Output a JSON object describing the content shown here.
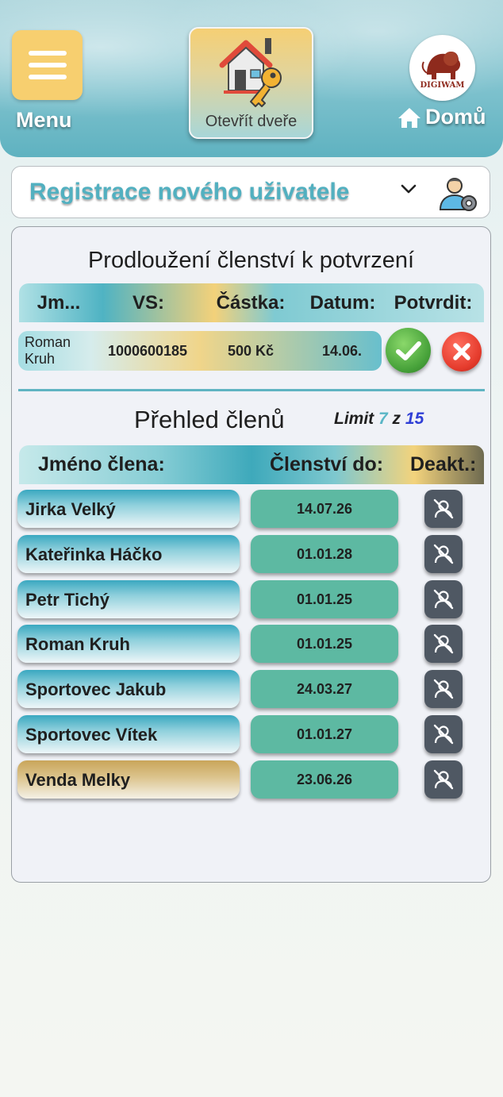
{
  "header": {
    "menu_label": "Menu",
    "door_button_label": "Otevřít dveře",
    "logo_text": "DIGIWAM",
    "home_label": "Domů"
  },
  "registration": {
    "title": "Registrace nového uživatele"
  },
  "pending": {
    "title": "Prodloužení členství k potvrzení",
    "columns": [
      "Jm...",
      "VS:",
      "Částka:",
      "Datum:",
      "Potvrdit:"
    ],
    "rows": [
      {
        "name": "Roman Kruh",
        "vs": "1000600185",
        "amount": "500 Kč",
        "date": "14.06."
      }
    ]
  },
  "members": {
    "title": "Přehled členů",
    "limit_label": "Limit",
    "limit_used": "7",
    "limit_sep": "z",
    "limit_total": "15",
    "columns": [
      "Jméno člena:",
      "Členství do:",
      "Deakt.:"
    ],
    "rows": [
      {
        "name": "Jirka Velký",
        "until": "14.07.26"
      },
      {
        "name": "Kateřinka Háčko",
        "until": "01.01.28"
      },
      {
        "name": "Petr Tichý",
        "until": "01.01.25"
      },
      {
        "name": "Roman Kruh",
        "until": "01.01.25"
      },
      {
        "name": "Sportovec Jakub",
        "until": "24.03.27"
      },
      {
        "name": "Sportovec Vítek",
        "until": "01.01.27"
      },
      {
        "name": "Venda Melky",
        "until": "23.06.26",
        "highlight": "gold"
      }
    ]
  },
  "colors": {
    "accent_teal": "#5fb4c2",
    "menu_yellow": "#f7cf6f",
    "date_green": "#5db9a2",
    "confirm_green": "#47a23a",
    "reject_red": "#e53b2c"
  },
  "icons": [
    "menu-icon",
    "house-key-icon",
    "lion-logo-icon",
    "home-icon",
    "chevron-down-icon",
    "user-gear-icon",
    "check-icon",
    "close-icon",
    "user-off-icon"
  ]
}
